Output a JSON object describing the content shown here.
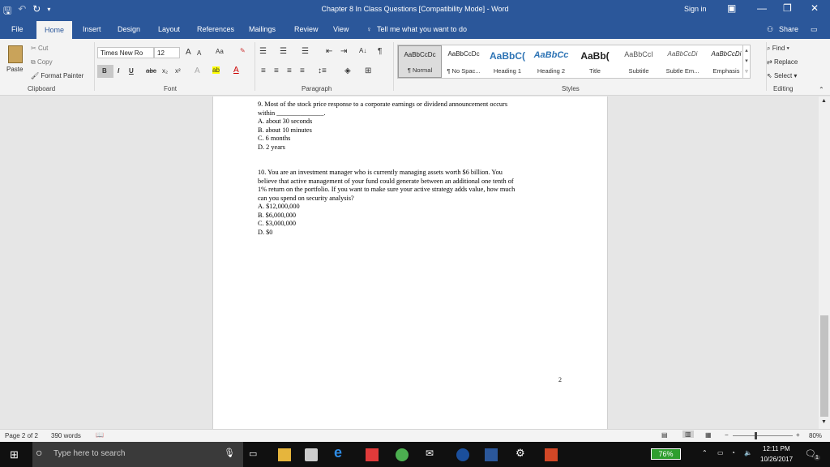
{
  "app": {
    "window_title": "Chapter 8 In Class Questions [Compatibility Mode]  -  Word",
    "sign_in": "Sign in",
    "undo_glyph": "↶",
    "redo_glyph": "↻",
    "save_glyph": "🖫"
  },
  "tabs": [
    "File",
    "Home",
    "Insert",
    "Design",
    "Layout",
    "References",
    "Mailings",
    "Review",
    "View"
  ],
  "tell_me": "Tell me what you want to do",
  "share": "Share",
  "clipboard": {
    "paste": "Paste",
    "cut": "Cut",
    "copy": "Copy",
    "format_painter": "Format Painter",
    "label": "Clipboard"
  },
  "font": {
    "name": "Times New Ro",
    "size": "12",
    "label": "Font",
    "aa": "Aa",
    "grow": "A",
    "shrink": "A",
    "bold": "B",
    "italic": "I",
    "underline": "U",
    "strike": "abc",
    "sub": "x₂",
    "sup": "x²"
  },
  "paragraph": {
    "label": "Paragraph",
    "pilcrow": "¶",
    "sort": "A↓"
  },
  "styles": {
    "label": "Styles",
    "items": [
      {
        "sample": "AaBbCcDc",
        "name": "¶ Normal"
      },
      {
        "sample": "AaBbCcDc",
        "name": "¶ No Spac..."
      },
      {
        "sample": "AaBbC(",
        "name": "Heading 1"
      },
      {
        "sample": "AaBbCc",
        "name": "Heading 2"
      },
      {
        "sample": "AaBb(",
        "name": "Title"
      },
      {
        "sample": "AaBbCcI",
        "name": "Subtitle"
      },
      {
        "sample": "AaBbCcDi",
        "name": "Subtle Em..."
      },
      {
        "sample": "AaBbCcDi",
        "name": "Emphasis"
      }
    ]
  },
  "editing": {
    "label": "Editing",
    "find": "Find",
    "replace": "Replace",
    "select": "Select"
  },
  "document": {
    "q9": [
      "9. Most of the stock price response to a corporate earnings or dividend announcement occurs",
      "within ______________.",
      "A. about 30 seconds",
      "B. about 10 minutes",
      "C. 6 months",
      "D. 2 years"
    ],
    "q10": [
      "10. You are an investment manager who is currently managing assets worth $6 billion. You",
      "believe that active management of your fund could generate between an additional one tenth of",
      "1% return on the portfolio. If you want to make sure your active strategy adds value, how much",
      "can you spend on security analysis?",
      "A. $12,000,000",
      "B. $6,000,000",
      "C. $3,000,000",
      "D. $0"
    ],
    "page_number": "2"
  },
  "status": {
    "page": "Page 2 of 2",
    "words": "390 words",
    "zoom": "80%",
    "zoom_level": 0.8
  },
  "taskbar": {
    "search_placeholder": "Type here to search",
    "battery": "76%",
    "time": "12:11 PM",
    "date": "10/26/2017",
    "notif_count": "1"
  }
}
